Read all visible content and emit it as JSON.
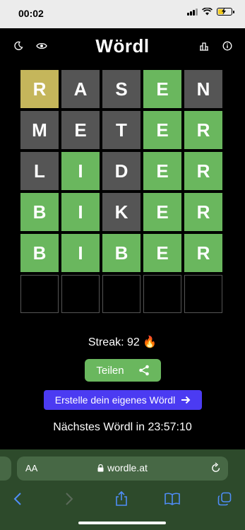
{
  "status": {
    "time": "00:02"
  },
  "header": {
    "title": "Wördl"
  },
  "board": [
    [
      {
        "letter": "R",
        "state": "present"
      },
      {
        "letter": "A",
        "state": "absent"
      },
      {
        "letter": "S",
        "state": "absent"
      },
      {
        "letter": "E",
        "state": "correct"
      },
      {
        "letter": "N",
        "state": "absent"
      }
    ],
    [
      {
        "letter": "M",
        "state": "absent"
      },
      {
        "letter": "E",
        "state": "absent"
      },
      {
        "letter": "T",
        "state": "absent"
      },
      {
        "letter": "E",
        "state": "correct"
      },
      {
        "letter": "R",
        "state": "correct"
      }
    ],
    [
      {
        "letter": "L",
        "state": "absent"
      },
      {
        "letter": "I",
        "state": "correct"
      },
      {
        "letter": "D",
        "state": "absent"
      },
      {
        "letter": "E",
        "state": "correct"
      },
      {
        "letter": "R",
        "state": "correct"
      }
    ],
    [
      {
        "letter": "B",
        "state": "correct"
      },
      {
        "letter": "I",
        "state": "correct"
      },
      {
        "letter": "K",
        "state": "absent"
      },
      {
        "letter": "E",
        "state": "correct"
      },
      {
        "letter": "R",
        "state": "correct"
      }
    ],
    [
      {
        "letter": "B",
        "state": "correct"
      },
      {
        "letter": "I",
        "state": "correct"
      },
      {
        "letter": "B",
        "state": "correct"
      },
      {
        "letter": "E",
        "state": "correct"
      },
      {
        "letter": "R",
        "state": "correct"
      }
    ],
    [
      {
        "letter": "",
        "state": "empty"
      },
      {
        "letter": "",
        "state": "empty"
      },
      {
        "letter": "",
        "state": "empty"
      },
      {
        "letter": "",
        "state": "empty"
      },
      {
        "letter": "",
        "state": "empty"
      }
    ]
  ],
  "streak": {
    "text": "Streak: 92 🔥"
  },
  "share": {
    "label": "Teilen"
  },
  "create": {
    "label": "Erstelle dein eigenes Wördl"
  },
  "next": {
    "text": "Nächstes Wördl in 23:57:10"
  },
  "browser": {
    "aa": "AA",
    "url": "wordle.at"
  },
  "colors": {
    "correct": "#6ab75e",
    "present": "#c5b65b",
    "absent": "#555555",
    "create": "#4b3bf2",
    "toolbar": "#2d4a2b"
  }
}
